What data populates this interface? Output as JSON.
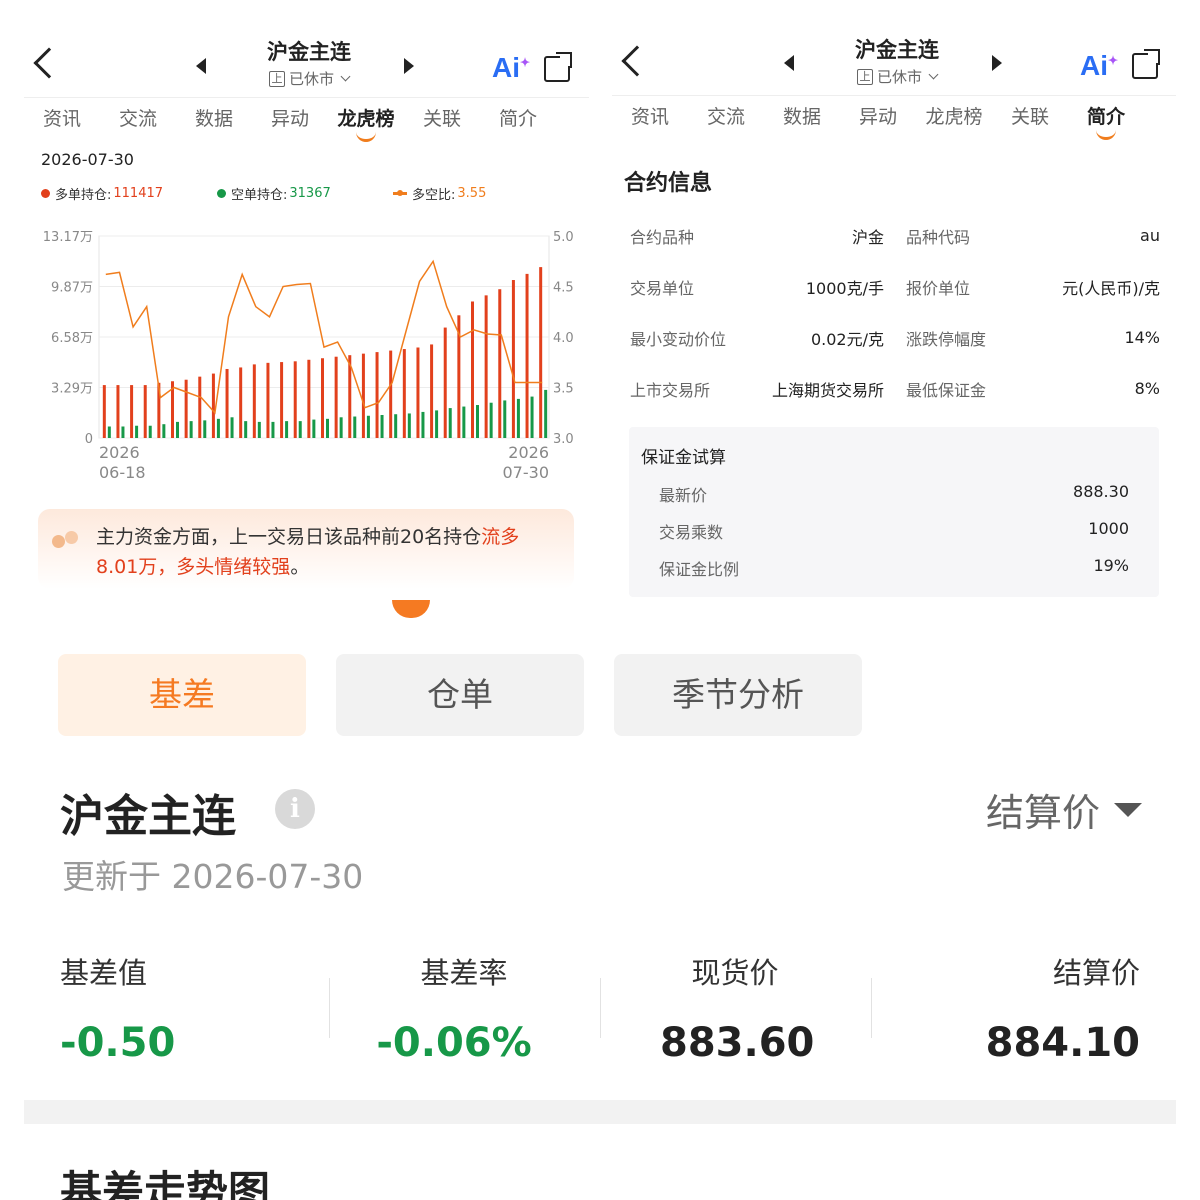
{
  "left": {
    "title": "沪金主连",
    "exchange_badge": "上",
    "market_status": "已休市",
    "tabs": [
      {
        "label": "资讯",
        "active": false
      },
      {
        "label": "交流",
        "active": false
      },
      {
        "label": "数据",
        "active": false
      },
      {
        "label": "异动",
        "active": false
      },
      {
        "label": "龙虎榜",
        "active": true
      },
      {
        "label": "关联",
        "active": false
      },
      {
        "label": "简介",
        "active": false
      }
    ],
    "chart_date": "2026-07-30",
    "legend": {
      "long_label": "多单持仓:",
      "long_value": "111417",
      "short_label": "空单持仓:",
      "short_value": "31367",
      "ratio_label": "多空比:",
      "ratio_value": "3.55"
    },
    "insight": {
      "prefix": "主力资金方面，上一交易日该品种前20名持仓",
      "highlight": "流多8.01万，多头情绪较强",
      "suffix": "。"
    }
  },
  "chart_data": {
    "type": "bar",
    "title": "",
    "x_start_label": [
      "2026",
      "06-18"
    ],
    "x_end_label": [
      "2026",
      "07-30"
    ],
    "y_left_ticks": [
      "13.17万",
      "9.87万",
      "6.58万",
      "3.29万",
      "0"
    ],
    "y_left_range": [
      0,
      131700
    ],
    "y_right_ticks": [
      "5.0",
      "4.5",
      "4.0",
      "3.5",
      "3.0"
    ],
    "y_right_range": [
      3.0,
      5.0
    ],
    "grid": true,
    "series": [
      {
        "name": "多单持仓",
        "color": "#e2401c",
        "type": "bar",
        "values": [
          34500,
          34500,
          34500,
          34500,
          36000,
          37000,
          38000,
          40000,
          42000,
          45000,
          46000,
          48000,
          49000,
          49500,
          50000,
          51000,
          52000,
          53000,
          54000,
          55000,
          56000,
          57000,
          58000,
          59000,
          61000,
          72000,
          80000,
          89000,
          93000,
          97000,
          103000,
          107000,
          111417
        ]
      },
      {
        "name": "空单持仓",
        "color": "#179848",
        "type": "bar",
        "values": [
          7500,
          7500,
          8000,
          8000,
          9000,
          10500,
          11000,
          11500,
          12500,
          13500,
          11000,
          10500,
          10500,
          11000,
          11000,
          12000,
          12500,
          13500,
          14000,
          14500,
          15000,
          15500,
          16000,
          17000,
          18000,
          19500,
          20500,
          21500,
          23000,
          24500,
          25500,
          27000,
          31367
        ]
      },
      {
        "name": "多空比",
        "color": "#f07d1d",
        "type": "line",
        "values": [
          4.62,
          4.64,
          4.1,
          4.3,
          3.4,
          3.5,
          3.45,
          3.4,
          3.25,
          4.2,
          4.62,
          4.3,
          4.2,
          4.5,
          4.52,
          4.53,
          3.9,
          3.95,
          3.7,
          3.3,
          3.35,
          3.55,
          4.05,
          4.55,
          4.75,
          4.3,
          4.0,
          4.07,
          4.03,
          4.02,
          3.55,
          3.55,
          3.55
        ]
      }
    ]
  },
  "right": {
    "title": "沪金主连",
    "exchange_badge": "上",
    "market_status": "已休市",
    "tabs": [
      {
        "label": "资讯",
        "active": false
      },
      {
        "label": "交流",
        "active": false
      },
      {
        "label": "数据",
        "active": false
      },
      {
        "label": "异动",
        "active": false
      },
      {
        "label": "龙虎榜",
        "active": false
      },
      {
        "label": "关联",
        "active": false
      },
      {
        "label": "简介",
        "active": true
      }
    ],
    "section_title": "合约信息",
    "rows": [
      {
        "k1": "合约品种",
        "v1": "沪金",
        "k2": "品种代码",
        "v2": "au"
      },
      {
        "k1": "交易单位",
        "v1": "1000克/手",
        "k2": "报价单位",
        "v2": "元(人民币)/克"
      },
      {
        "k1": "最小变动价位",
        "v1": "0.02元/克",
        "k2": "涨跌停幅度",
        "v2": "14%"
      },
      {
        "k1": "上市交易所",
        "v1": "上海期货交易所",
        "k2": "最低保证金",
        "v2": "8%"
      }
    ],
    "calc": {
      "title": "保证金试算",
      "rows": [
        {
          "k": "最新价",
          "v": "888.30"
        },
        {
          "k": "交易乘数",
          "v": "1000"
        },
        {
          "k": "保证金比例",
          "v": "19%"
        }
      ]
    }
  },
  "bottom": {
    "seg_tabs": [
      {
        "label": "基差",
        "active": true
      },
      {
        "label": "仓单",
        "active": false
      },
      {
        "label": "季节分析",
        "active": false
      }
    ],
    "title": "沪金主连",
    "info_glyph": "i",
    "price_type": "结算价",
    "update_text": "更新于 2026-07-30",
    "stats": [
      {
        "label": "基差值",
        "value": "-0.50"
      },
      {
        "label": "基差率",
        "value": "-0.06%"
      },
      {
        "label": "现货价",
        "value": "883.60"
      },
      {
        "label": "结算价",
        "value": "884.10"
      }
    ],
    "next_section_title": "基差走势图"
  },
  "colors": {
    "accent": "#f57a22",
    "long": "#e2401c",
    "short": "#179848",
    "ratio": "#f07d1d"
  }
}
